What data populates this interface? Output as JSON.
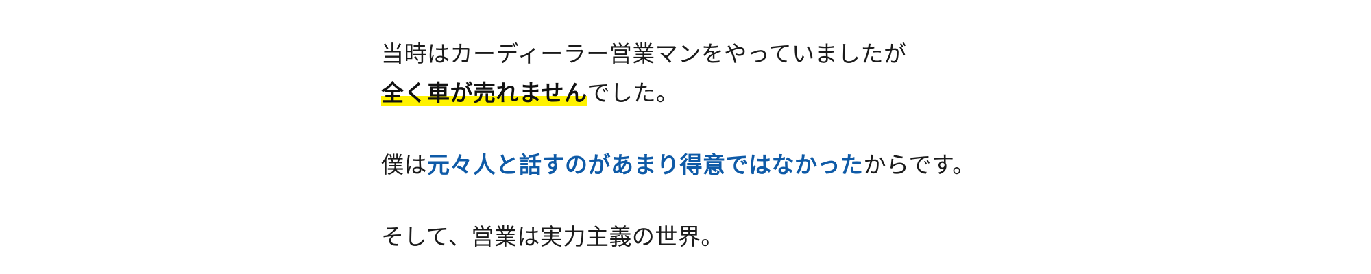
{
  "article": {
    "paragraphs": [
      {
        "line1": "当時はカーディーラー営業マンをやっていましたが",
        "line2_highlight": "全く車が売れません",
        "line2_rest": "でした。"
      },
      {
        "before": "僕は",
        "emphasis": "元々人と話すのがあまり得意ではなかった",
        "after": "からです。"
      },
      {
        "text": "そして、営業は実力主義の世界。"
      }
    ]
  },
  "colors": {
    "text": "#1a1a1a",
    "highlight_marker": "#fff200",
    "emphasis_blue": "#0e5aa7",
    "background": "#ffffff"
  }
}
